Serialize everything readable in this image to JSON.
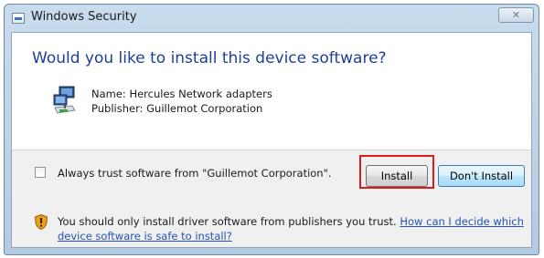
{
  "window": {
    "title": "Windows Security",
    "close_label": "✕"
  },
  "main": {
    "heading": "Would you like to install this device software?",
    "device_name": "Name: Hercules Network adapters",
    "device_publisher": "Publisher: Guillemot Corporation"
  },
  "footer": {
    "checkbox_label": "Always trust software from \"Guillemot Corporation\".",
    "checkbox_checked": false,
    "install_label": "Install",
    "dont_install_label": "Don't Install",
    "warning_text": "You should only install driver software from publishers you trust.",
    "link_text": "How can I decide which device software is safe to install?"
  },
  "colors": {
    "heading": "#1f3e9b",
    "link": "#2353b9",
    "highlight": "#e01b1b"
  },
  "icons": {
    "title": "security-window-icon",
    "device": "network-adapter-icon",
    "warning": "shield-warning-icon"
  }
}
